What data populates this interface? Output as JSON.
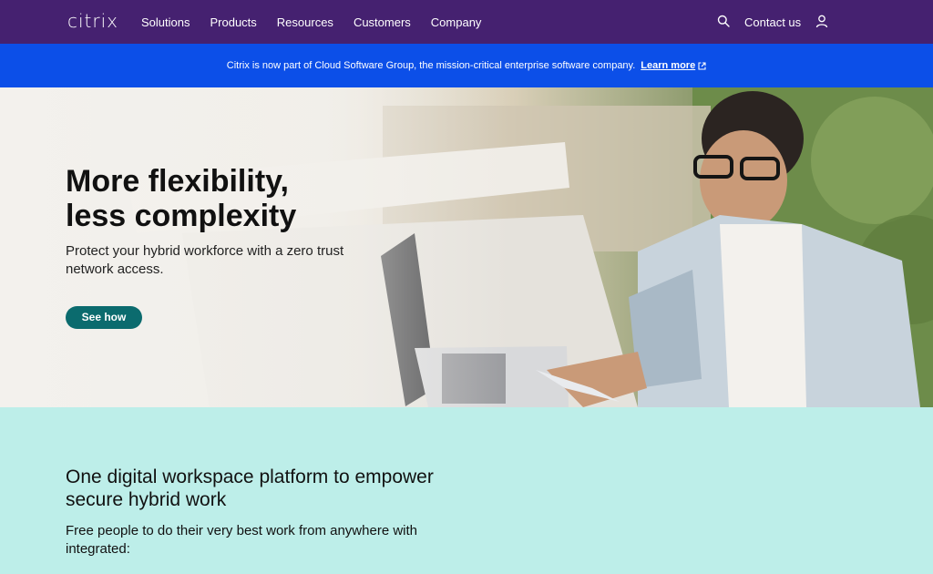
{
  "nav": {
    "logo": "citrix",
    "links": [
      "Solutions",
      "Products",
      "Resources",
      "Customers",
      "Company"
    ],
    "contact": "Contact us",
    "icons": {
      "search": "search-icon",
      "user": "user-icon"
    }
  },
  "banner": {
    "text": "Citrix is now part of Cloud Software Group, the mission-critical enterprise software company.",
    "link": "Learn more",
    "link_icon": "external-link-icon"
  },
  "hero": {
    "title_line1": "More flexibility,",
    "title_line2": "less complexity",
    "subtitle": "Protect your hybrid workforce with a zero trust network access.",
    "button": "See how"
  },
  "section": {
    "title": "One digital workspace platform to empower secure hybrid work",
    "subtitle": "Free people to do their very best work from anywhere with integrated:"
  },
  "colors": {
    "nav_bg": "#452170",
    "banner_bg": "#0c4fe8",
    "button_bg": "#0b6b6e",
    "section_bg": "#bdeee9"
  }
}
